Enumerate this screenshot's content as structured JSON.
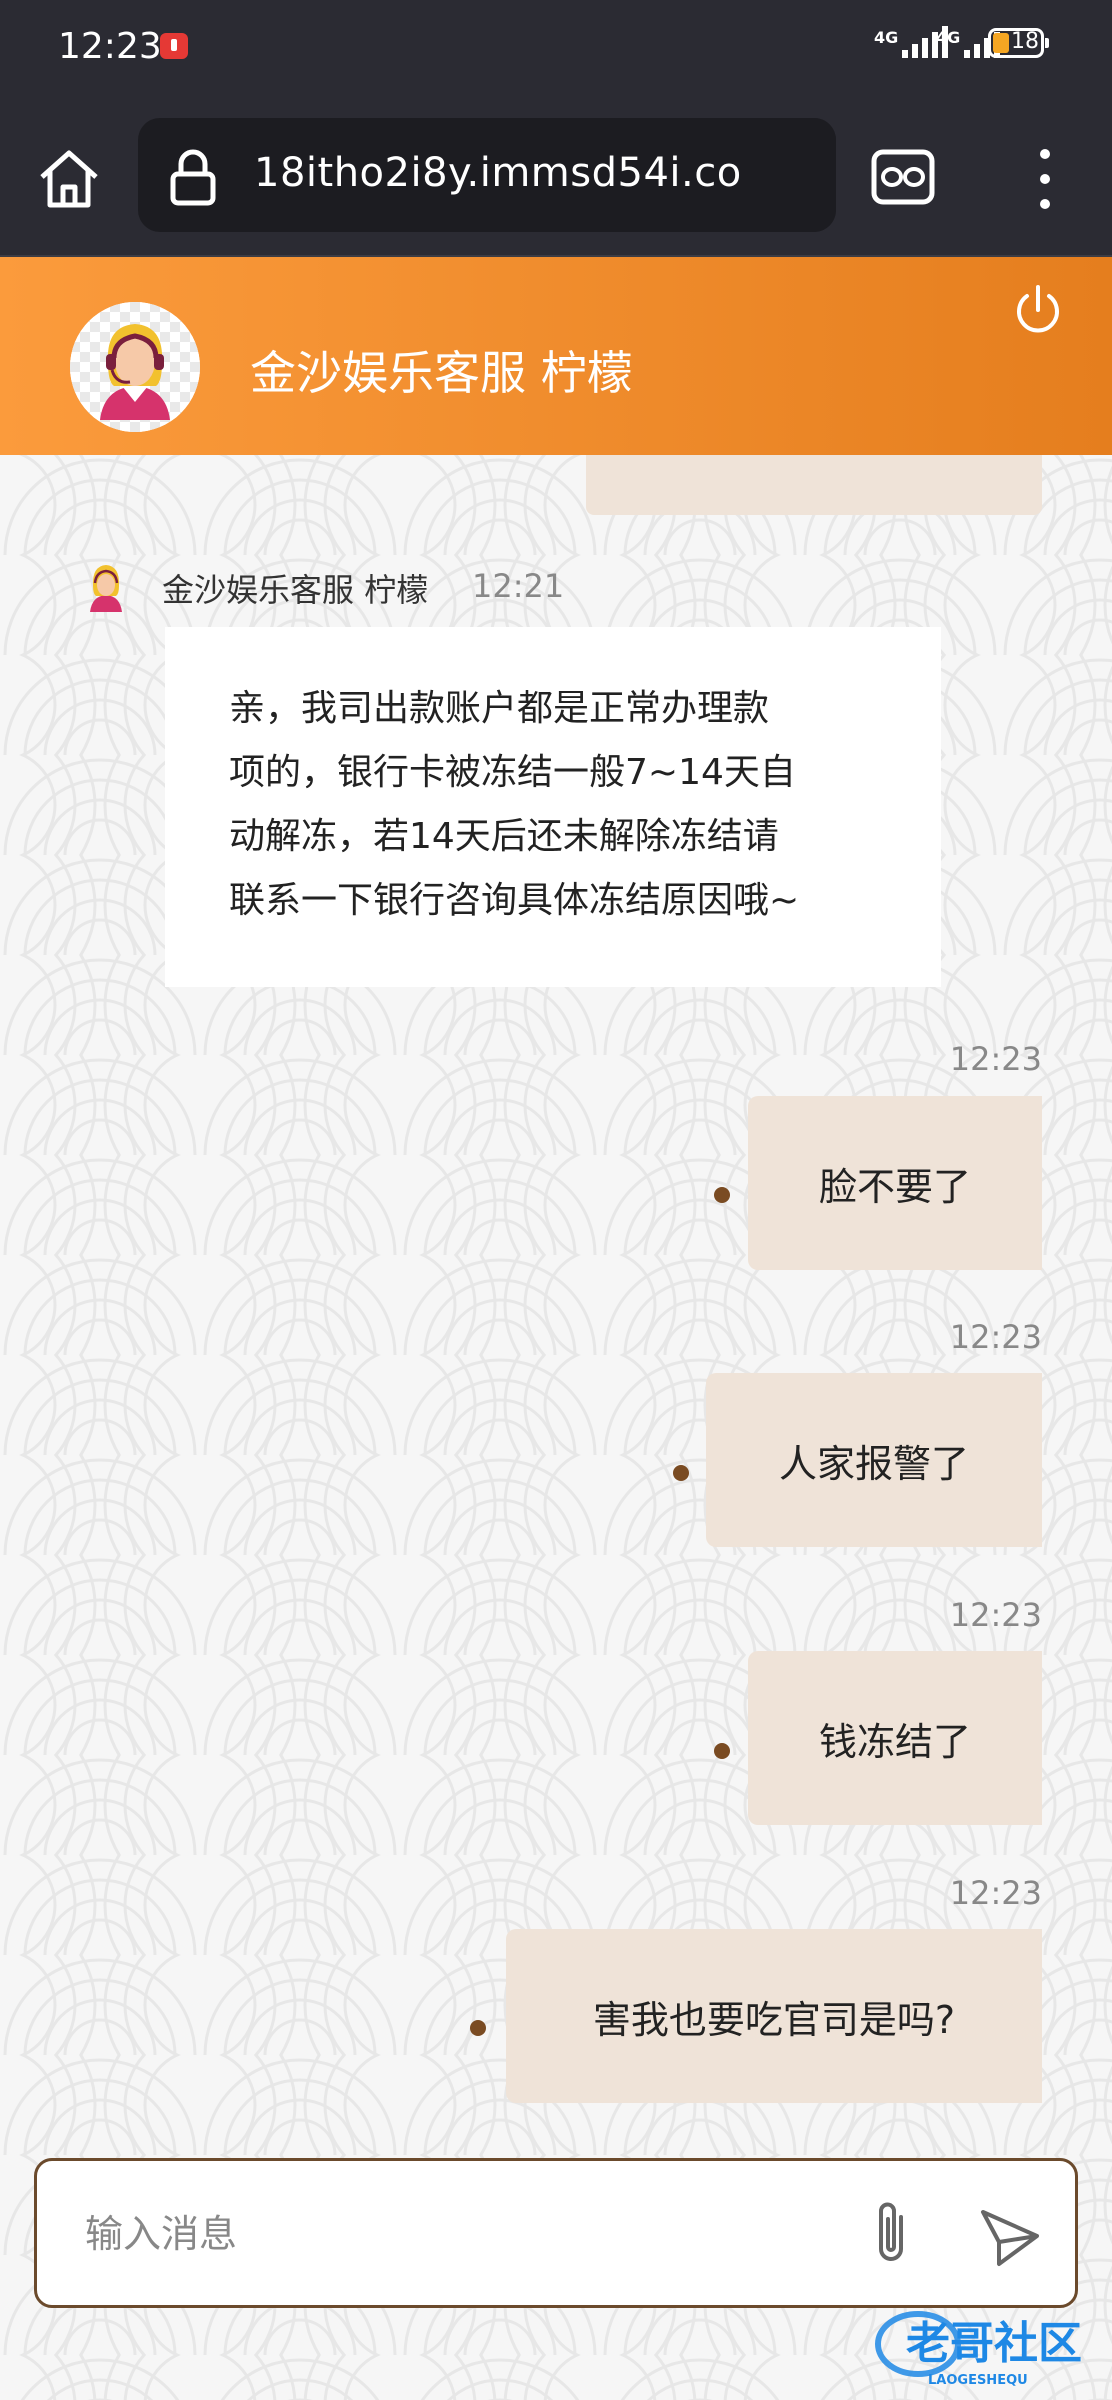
{
  "status_bar": {
    "time": "12:23",
    "sim1_type": "4G",
    "sim2_type": "4G",
    "battery": "18"
  },
  "browser": {
    "url": "18itho2i8y.immsd54i.co"
  },
  "header": {
    "title": "金沙娱乐客服 柠檬"
  },
  "messages": {
    "agent": {
      "name": "金沙娱乐客服 柠檬",
      "time": "12:21",
      "lines": [
        "亲，我司出款账户都是正常办理款",
        "项的，银行卡被冻结一般7~14天自",
        "动解冻，若14天后还未解除冻结请",
        "联系一下银行咨询具体冻结原因哦~"
      ]
    },
    "user": [
      {
        "time": "12:23",
        "text": "脸不要了"
      },
      {
        "time": "12:23",
        "text": "人家报警了"
      },
      {
        "time": "12:23",
        "text": "钱冻结了"
      },
      {
        "time": "12:23",
        "text": "害我也要吃官司是吗?"
      }
    ]
  },
  "input": {
    "placeholder": "输入消息"
  },
  "watermark": {
    "text": "老哥社区",
    "sub": "LAOGESHEQU"
  },
  "colors": {
    "header_start": "#fb9b3c",
    "header_end": "#e57e1e",
    "user_bubble": "#efe3d8",
    "input_border": "#6b4a2c"
  }
}
